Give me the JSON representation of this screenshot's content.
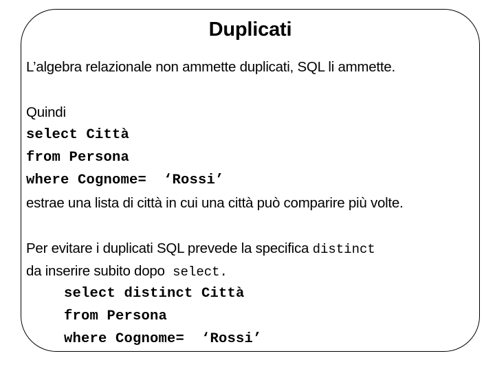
{
  "slide": {
    "title": "Duplicati",
    "frame": {
      "border_color": "#000000",
      "background_color": "#ffffff"
    },
    "intro_line": "L’algebra relazionale non ammette duplicati, SQL li ammette.",
    "quindi_label": "Quindi",
    "first_query": [
      "select Città",
      "from Persona",
      "where Cognome=  ‘Rossi’"
    ],
    "first_query_result": "estrae una lista di città in cui una città può comparire più volte.",
    "distinct_paragraph": {
      "part1": "Per evitare i duplicati SQL prevede la specifica ",
      "keyword1": "distinct",
      "part2": "da inserire subito dopo ",
      "keyword2": "select."
    },
    "second_query": [
      "select distinct Città",
      "from Persona",
      "where Cognome=  ‘Rossi’"
    ]
  }
}
